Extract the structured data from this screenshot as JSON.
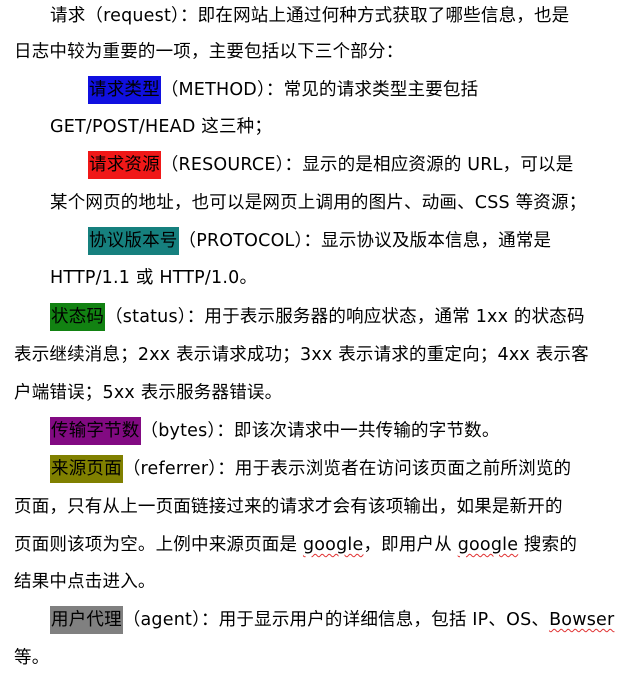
{
  "colors": {
    "method": "#1010e0",
    "resource": "#f01818",
    "protocol": "#16807e",
    "status": "#128212",
    "bytes": "#820a82",
    "referrer": "#808000",
    "agent": "#808080",
    "spellcheck": "#e03030"
  },
  "request": {
    "line1": "请求（request）：即在网站上通过何种方式获取了哪些信息，也是",
    "line2": "日志中较为重要的一项，主要包括以下三个部分："
  },
  "method": {
    "term": "请求类型",
    "rest": "（METHOD）：常见的请求类型主要包括",
    "line2": "GET/POST/HEAD 这三种；"
  },
  "resource": {
    "term": "请求资源",
    "rest": "（RESOURCE）：显示的是相应资源的 URL，可以是",
    "line2": "某个网页的地址，也可以是网页上调用的图片、动画、CSS 等资源；"
  },
  "protocol": {
    "term": "协议版本号",
    "rest": "（PROTOCOL）：显示协议及版本信息，通常是",
    "line2": "HTTP/1.1 或 HTTP/1.0。"
  },
  "status": {
    "term": "状态码",
    "rest": "（status）：用于表示服务器的响应状态，通常 1xx 的状态码",
    "line2": "表示继续消息；2xx 表示请求成功；3xx 表示请求的重定向；4xx 表示客",
    "line3": "户端错误；5xx 表示服务器错误。"
  },
  "bytes": {
    "term": "传输字节数",
    "rest": "（bytes）：即该次请求中一共传输的字节数。"
  },
  "referrer": {
    "term": "来源页面",
    "rest": "（referrer）：用于表示浏览者在访问该页面之前所浏览的",
    "line2": "页面，只有从上一页面链接过来的请求才会有该项输出，如果是新开的",
    "line3_a": "页面则该项为空。上例中来源页面是 ",
    "line3_b": "google",
    "line3_c": "，即用户从 ",
    "line3_d": "google",
    "line3_e": " 搜索的",
    "line4": "结果中点击进入。"
  },
  "agent": {
    "term": "用户代理",
    "rest_a": "（agent）：用于显示用户的详细信息，包括 IP、OS、",
    "rest_b": "Bowser",
    "line2": "等。"
  }
}
